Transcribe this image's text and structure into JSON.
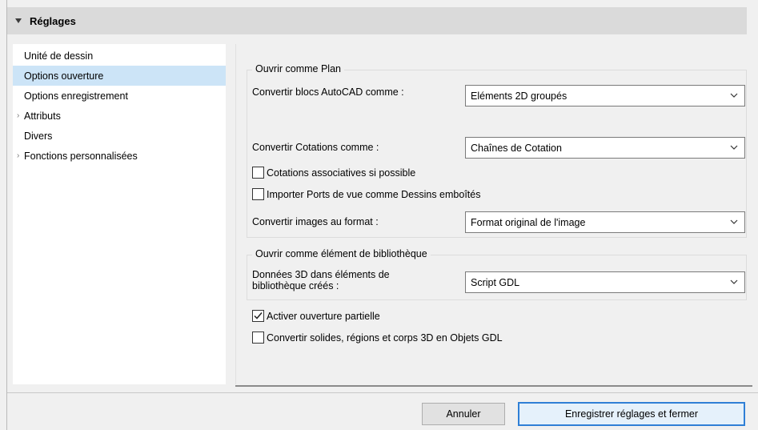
{
  "header": {
    "title": "Réglages"
  },
  "sidebar": {
    "items": [
      {
        "label": "Unité de dessin"
      },
      {
        "label": "Options ouverture"
      },
      {
        "label": "Options enregistrement"
      },
      {
        "label": "Attributs"
      },
      {
        "label": "Divers"
      },
      {
        "label": "Fonctions personnalisées"
      }
    ]
  },
  "plan": {
    "group_title": "Ouvrir comme Plan",
    "autocad_label": "Convertir blocs AutoCAD comme :",
    "autocad_value": "Eléments 2D groupés",
    "cotations_label": "Convertir Cotations comme :",
    "cotations_value": "Chaînes de Cotation",
    "assoc_label": "Cotations associatives si possible",
    "assoc_checked": false,
    "ports_label": "Importer Ports de vue comme Dessins emboîtés",
    "ports_checked": false,
    "images_label": "Convertir images au format :",
    "images_value": "Format original de l'image"
  },
  "library": {
    "group_title": "Ouvrir comme élément de bibliothèque",
    "data3d_label_line1": "Données 3D dans éléments de",
    "data3d_label_line2": "bibliothèque créés :",
    "data3d_value": "Script GDL"
  },
  "options": {
    "partial_label": "Activer ouverture partielle",
    "partial_checked": true,
    "convert_label": "Convertir solides, régions et corps 3D en Objets GDL",
    "convert_checked": false
  },
  "footer": {
    "cancel_label": "Annuler",
    "save_label": "Enregistrer réglages et fermer"
  }
}
